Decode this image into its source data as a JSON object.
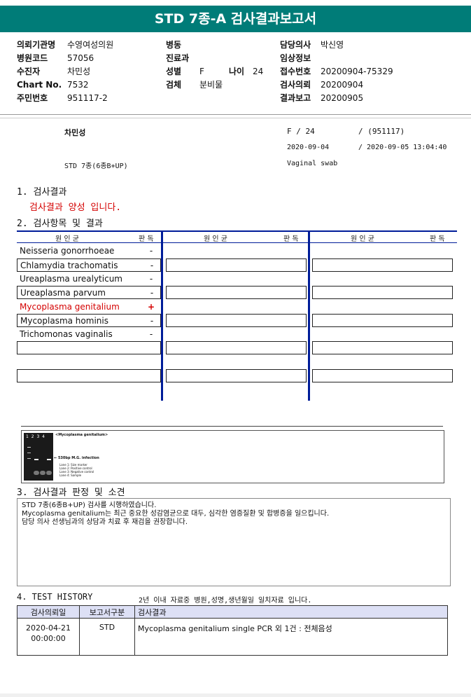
{
  "title": "STD 7종-A 검사결과보고서",
  "header": {
    "hospital_label": "의뢰기관명",
    "hospital": "수영여성의원",
    "code_label": "병원코드",
    "code": "57056",
    "patient_label": "수진자",
    "patient": "차민성",
    "chart_label": "Chart No.",
    "chart": "7532",
    "ssn_label": "주민번호",
    "ssn": "951117-2",
    "ward_label": "병동",
    "ward": "",
    "dept_label": "진료과",
    "dept": "",
    "sex_label": "성별",
    "sex": "F",
    "age_label": "나이",
    "age": "24",
    "specimen_label": "검체",
    "specimen": "분비물",
    "doctor_label": "담당의사",
    "doctor": "박신영",
    "clinical_label": "임상정보",
    "clinical": "",
    "receipt_label": "접수번호",
    "receipt": "20200904-75329",
    "request_label": "검사의뢰",
    "request": "20200904",
    "report_label": "결과보고",
    "report": "20200905"
  },
  "summary": {
    "name": "차민성",
    "sex_age": "F  /  24",
    "birth": "/ (951117)",
    "date1": "2020-09-04",
    "date2": "/ 2020-09-05 13:04:40",
    "test": "STD 7종(6종B+UP)",
    "specimen": "Vaginal swab"
  },
  "section1": {
    "title": "1. 검사결과",
    "result": "검사결과 양성 입니다."
  },
  "section2": {
    "title": "2. 검사항목 및 결과",
    "col_pathogen": "원 인 균",
    "col_judgement": "판 독",
    "items": [
      {
        "name": "Neisseria gonorrhoeae",
        "result": "-",
        "color": "#111111"
      },
      {
        "name": "Chlamydia trachomatis",
        "result": "-",
        "color": "#111111"
      },
      {
        "name": "Ureaplasma urealyticum",
        "result": "-",
        "color": "#111111"
      },
      {
        "name": "Ureaplasma parvum",
        "result": "-",
        "color": "#111111"
      },
      {
        "name": "Mycoplasma genitalium",
        "result": "+",
        "color": "#d40000"
      },
      {
        "name": "Mycoplasma hominis",
        "result": "-",
        "color": "#111111"
      },
      {
        "name": "Trichomonas vaginalis",
        "result": "-",
        "color": "#111111"
      }
    ]
  },
  "gel": {
    "lanes": "1 2 3 4",
    "caption": "<Mycoplasma genitalium>",
    "band": "530bp M.G. infection",
    "legend": [
      "Lane 1: Size marker",
      "Lane 2: Positive control",
      "Lane 3: Negative control",
      "Lane 4: Sample"
    ]
  },
  "section3": {
    "title": "3. 검사결과 판정 및 소견",
    "lines": [
      "STD 7종(6종B+UP) 검사를 시행하였습니다.",
      "Mycoplasma genitalium는 최근 중요한 성감염균으로 대두, 심각한 염증질환 및 합병증을 일으킵니다.",
      "담당 의사 선생님과의 상담과 치료 후 재검을 권장합니다."
    ]
  },
  "section4": {
    "title": "4. TEST HISTORY",
    "note": "2년 이내 자료중 병원,성명,생년월일 일치자료 입니다.",
    "headers": [
      "검사의뢰일",
      "보고서구분",
      "검사결과"
    ],
    "rows": [
      {
        "date": "2020-04-21",
        "time": "00:00:00",
        "type": "STD",
        "result": "Mycoplasma genitalium single PCR 외 1건 : 전체음성"
      }
    ]
  }
}
